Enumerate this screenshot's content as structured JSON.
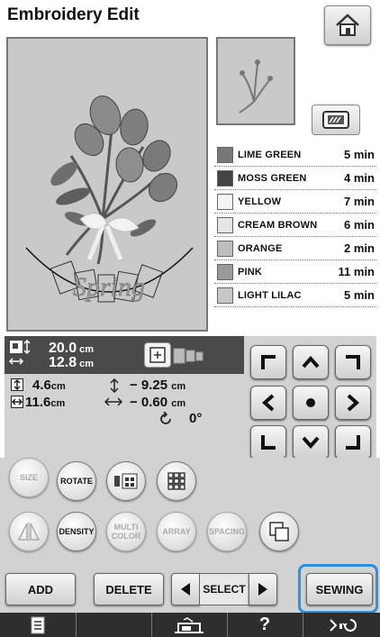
{
  "header": {
    "title": "Embroidery Edit"
  },
  "colors": [
    {
      "name": "LIME GREEN",
      "time": "5 min",
      "swatch": "#777777"
    },
    {
      "name": "MOSS GREEN",
      "time": "4 min",
      "swatch": "#444444"
    },
    {
      "name": "YELLOW",
      "time": "7 min",
      "swatch": "#f4f4f4"
    },
    {
      "name": "CREAM BROWN",
      "time": "6 min",
      "swatch": "#e6e6e6"
    },
    {
      "name": "ORANGE",
      "time": "2 min",
      "swatch": "#bdbdbd"
    },
    {
      "name": "PINK",
      "time": "11 min",
      "swatch": "#9a9a9a"
    },
    {
      "name": "LIGHT LILAC",
      "time": "5 min",
      "swatch": "#c7c7c7"
    }
  ],
  "edit_area": {
    "text": "Spring"
  },
  "pattern_size": {
    "height": "20.0",
    "width": "12.8",
    "unit": "cm"
  },
  "measurements": {
    "box_height": "4.6",
    "box_width": "11.6",
    "vertical_offset": "− 9.25",
    "horizontal_offset": "− 0.60",
    "unit": "cm",
    "rotation": "0°"
  },
  "buttons": {
    "size": "SIZE",
    "rotate": "ROTATE",
    "density": "DENSITY",
    "multi_color": "MULTI COLOR",
    "array": "ARRAY",
    "spacing": "SPACING",
    "add": "ADD",
    "delete": "DELETE",
    "select": "SELECT",
    "sewing": "SEWING"
  },
  "nav": {
    "help": "?"
  },
  "accent": "#2f8fe0"
}
